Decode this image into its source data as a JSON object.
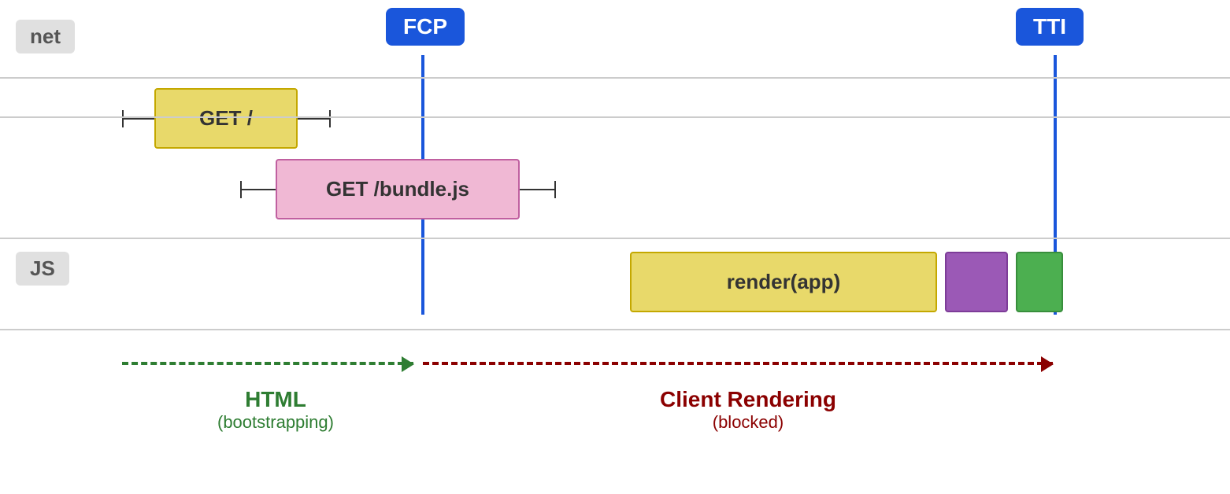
{
  "markers": {
    "fcp_label": "FCP",
    "tti_label": "TTI"
  },
  "rows": {
    "net_label": "net",
    "js_label": "JS"
  },
  "boxes": {
    "get_root": "GET /",
    "get_bundle": "GET /bundle.js",
    "render_app": "render(app)"
  },
  "bottom": {
    "html_main": "HTML",
    "html_sub": "(bootstrapping)",
    "cr_main": "Client Rendering",
    "cr_sub": "(blocked)"
  },
  "colors": {
    "fcp_bg": "#1a56db",
    "tti_bg": "#1a56db",
    "get_root_bg": "#e8d96a",
    "get_bundle_bg": "#f0b8d4",
    "render_app_bg": "#e8d96a",
    "purple_bg": "#9b59b6",
    "green_bg": "#4caf50",
    "html_color": "#2e7d32",
    "cr_color": "#8b0000"
  }
}
